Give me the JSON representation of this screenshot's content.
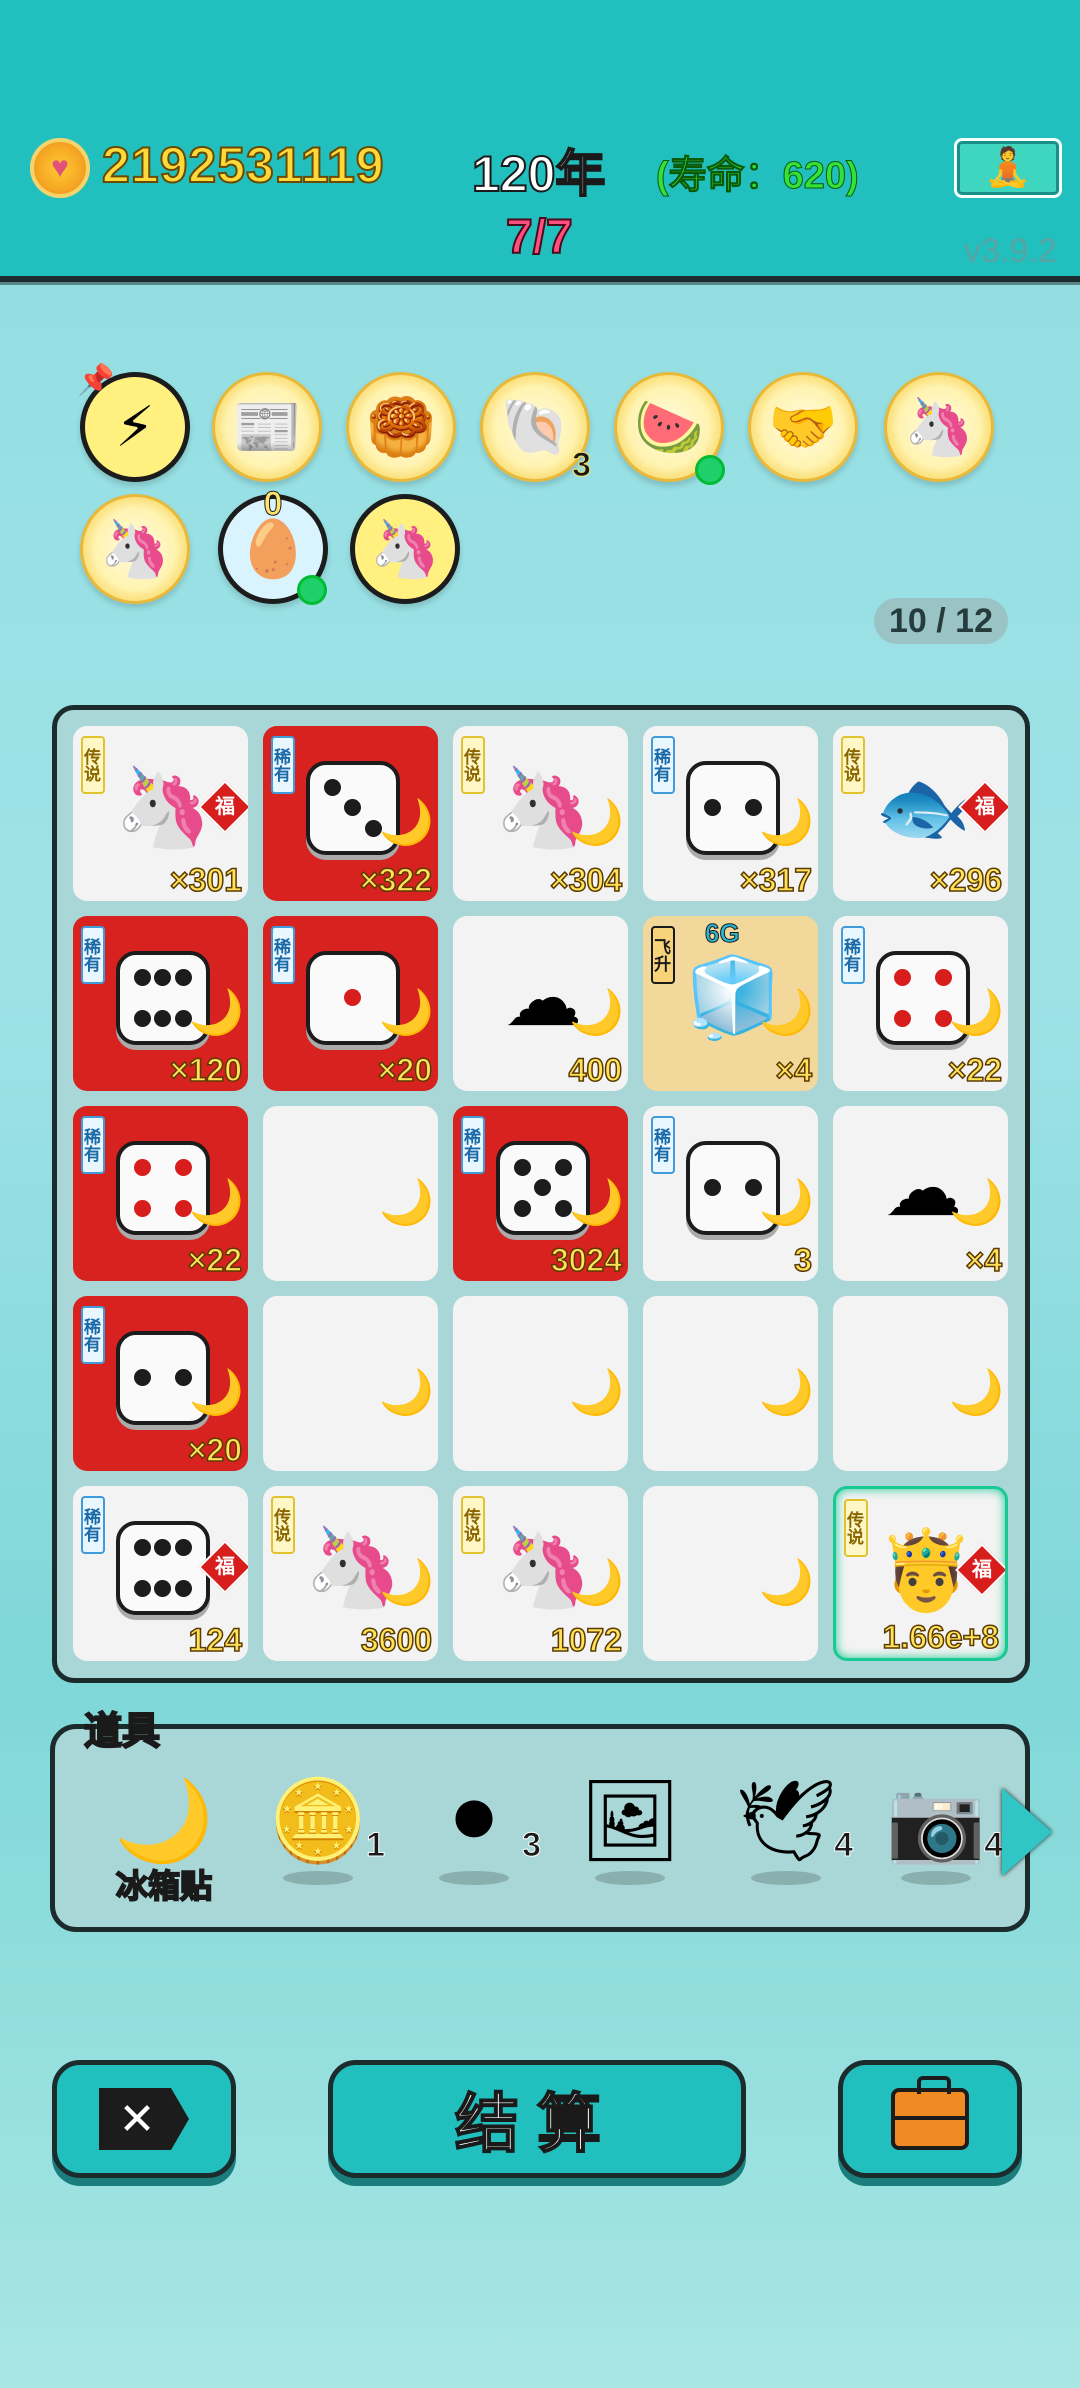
{
  "header": {
    "coins": "2192531119",
    "year": "120年",
    "life": "(寿命：620)",
    "round": "7/7",
    "version": "v3.9.2",
    "yoga_icon": "meditation-icon"
  },
  "relics": [
    {
      "icon": "lightning-icon",
      "glyph": "⚡"
    },
    {
      "icon": "time-magazine-icon",
      "glyph": "📰"
    },
    {
      "icon": "mooncake-icon",
      "glyph": "🥮"
    },
    {
      "icon": "shell-icon",
      "glyph": "🐚",
      "badge": "3"
    },
    {
      "icon": "fruit-basket-icon",
      "glyph": "🍉"
    },
    {
      "icon": "handshake-icon",
      "glyph": "🤝"
    },
    {
      "icon": "unicorn-icon",
      "glyph": "🦄"
    },
    {
      "icon": "unicorn-icon",
      "glyph": "🦄"
    },
    {
      "icon": "egg-tray-icon",
      "glyph": "🥚",
      "top": "0"
    },
    {
      "icon": "unicorn-icon",
      "glyph": "🦄"
    }
  ],
  "page_count": "10 / 12",
  "board": {
    "tags": {
      "legend": "传说",
      "rare": "稀有",
      "ascend": "飞升"
    },
    "fu": "福",
    "cells": [
      {
        "item": "unicorn",
        "tag": "legend",
        "fu": true,
        "count": "×301"
      },
      {
        "item": "dice",
        "pips": 3,
        "tag": "rare",
        "bg": "red",
        "count": "×322"
      },
      {
        "item": "unicorn",
        "tag": "legend",
        "count": "×304"
      },
      {
        "item": "dice",
        "pips": 2,
        "tag": "rare",
        "count": "×317"
      },
      {
        "item": "koi",
        "tag": "legend",
        "fu": true,
        "count": "×296"
      },
      {
        "item": "dice",
        "pips": 6,
        "tag": "rare",
        "bg": "red",
        "count": "×120"
      },
      {
        "item": "dice",
        "pips": 1,
        "red_pips": true,
        "tag": "rare",
        "bg": "red",
        "count": "×20"
      },
      {
        "item": "cloud",
        "count": "400"
      },
      {
        "item": "fridge",
        "tag": "ascend",
        "bg": "gold",
        "top": "6G",
        "count": "×4"
      },
      {
        "item": "dice",
        "pips": 4,
        "red_pips": true,
        "tag": "rare",
        "count": "×22"
      },
      {
        "item": "dice",
        "pips": 4,
        "red_pips": true,
        "tag": "rare",
        "bg": "red",
        "count": "×22"
      },
      {
        "item": "empty"
      },
      {
        "item": "dice",
        "pips": 5,
        "tag": "rare",
        "bg": "red",
        "count": "3024"
      },
      {
        "item": "dice",
        "pips": 2,
        "tag": "rare",
        "count": "3"
      },
      {
        "item": "cloud",
        "count": "×4"
      },
      {
        "item": "dice",
        "pips": 2,
        "tag": "rare",
        "bg": "red",
        "count": "×20"
      },
      {
        "item": "empty"
      },
      {
        "item": "empty"
      },
      {
        "item": "empty"
      },
      {
        "item": "empty"
      },
      {
        "item": "dice",
        "pips": 6,
        "tag": "rare",
        "fu": true,
        "count": "124"
      },
      {
        "item": "unicorn",
        "tag": "legend",
        "count": "3600"
      },
      {
        "item": "unicorn",
        "tag": "legend",
        "count": "1072"
      },
      {
        "item": "empty"
      },
      {
        "item": "king",
        "tag": "legend",
        "fu": true,
        "glow": true,
        "count": "1.66e+8"
      }
    ]
  },
  "props": {
    "title": "道具",
    "items": [
      {
        "icon": "moon-icon",
        "glyph": "🌙",
        "label": "冰箱贴"
      },
      {
        "icon": "coin-dollar-icon",
        "glyph": "🪙",
        "count": "1"
      },
      {
        "icon": "black-hole-icon",
        "glyph": "⚫",
        "count": "3"
      },
      {
        "icon": "frame-icon",
        "glyph": "🖼"
      },
      {
        "icon": "pigeon-icon",
        "glyph": "🕊",
        "count": "4"
      },
      {
        "icon": "camera-icon",
        "glyph": "📷",
        "count": "4"
      }
    ]
  },
  "buttons": {
    "close": "✕",
    "settle": "结算"
  }
}
